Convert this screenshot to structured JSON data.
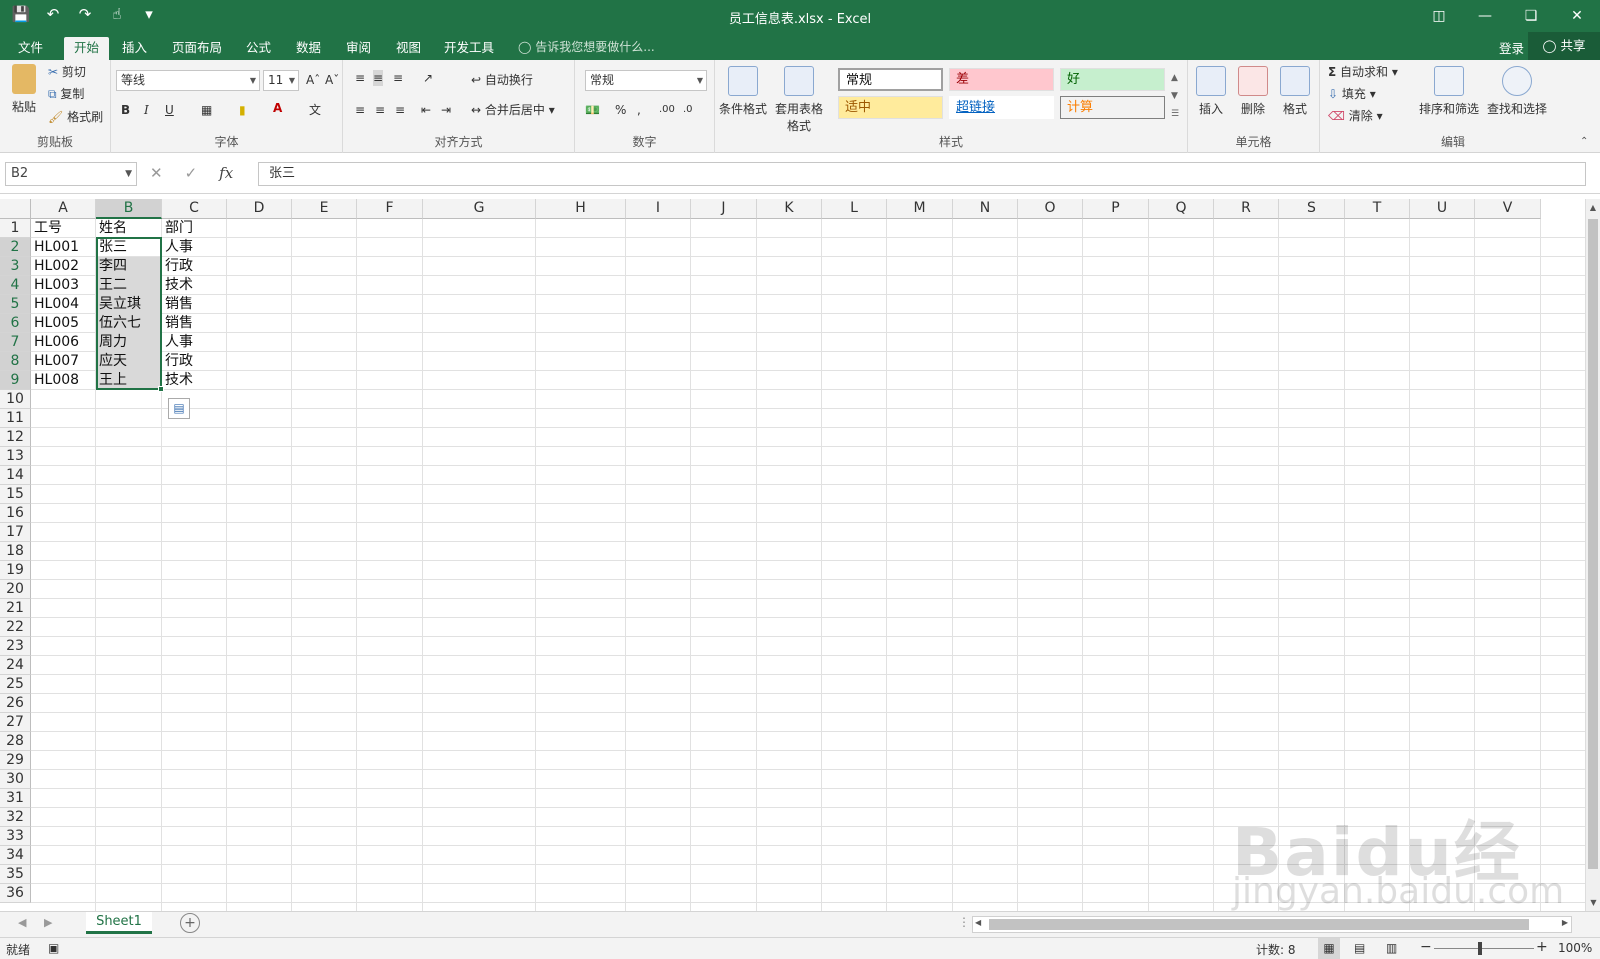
{
  "window": {
    "title": "员工信息表.xlsx - Excel"
  },
  "tabs": [
    "文件",
    "开始",
    "插入",
    "页面布局",
    "公式",
    "数据",
    "审阅",
    "视图",
    "开发工具"
  ],
  "tellme": "告诉我您想要做什么...",
  "account": {
    "login": "登录",
    "share": "共享"
  },
  "clipboard": {
    "paste": "粘贴",
    "cut": "剪切",
    "copy": "复制",
    "painter": "格式刷",
    "label": "剪贴板"
  },
  "font": {
    "name": "等线",
    "size": "11",
    "label": "字体"
  },
  "align": {
    "wrap": "自动换行",
    "merge": "合并后居中",
    "label": "对齐方式"
  },
  "number": {
    "format": "常规",
    "label": "数字"
  },
  "styles": {
    "cond": "条件格式",
    "table": "套用表格格式",
    "cells": [
      "常规",
      "差",
      "好",
      "适中",
      "超链接",
      "计算"
    ],
    "label": "样式"
  },
  "cells_group": {
    "insert": "插入",
    "delete": "删除",
    "format": "格式",
    "label": "单元格"
  },
  "editing": {
    "autosum": "自动求和",
    "fill": "填充",
    "clear": "清除",
    "sort": "排序和筛选",
    "find": "查找和选择",
    "label": "编辑"
  },
  "formula": {
    "namebox": "B2",
    "value": "张三"
  },
  "columns": [
    "A",
    "B",
    "C",
    "D",
    "E",
    "F",
    "G",
    "H",
    "I",
    "J",
    "K",
    "L",
    "M",
    "N",
    "O",
    "P",
    "Q",
    "R",
    "S",
    "T",
    "U",
    "V"
  ],
  "rows": [
    "1",
    "2",
    "3",
    "4",
    "5",
    "6",
    "7",
    "8",
    "9",
    "10",
    "11",
    "12",
    "13",
    "14",
    "15",
    "16",
    "17",
    "18",
    "19",
    "20",
    "21",
    "22",
    "23",
    "24",
    "25",
    "26",
    "27",
    "28",
    "29",
    "30",
    "31",
    "32",
    "33",
    "34",
    "35",
    "36"
  ],
  "table": [
    [
      "工号",
      "姓名",
      "部门"
    ],
    [
      "HL001",
      "张三",
      "人事"
    ],
    [
      "HL002",
      "李四",
      "行政"
    ],
    [
      "HL003",
      "王二",
      "技术"
    ],
    [
      "HL004",
      "吴立琪",
      "销售"
    ],
    [
      "HL005",
      "伍六七",
      "销售"
    ],
    [
      "HL006",
      "周力",
      "人事"
    ],
    [
      "HL007",
      "应天",
      "行政"
    ],
    [
      "HL008",
      "王上",
      "技术"
    ]
  ],
  "sheet": {
    "name": "Sheet1"
  },
  "status": {
    "ready": "就绪",
    "count": "计数: 8",
    "zoom": "100%"
  },
  "watermark": {
    "brand": "Baidu经验",
    "url": "jingyan.baidu.com"
  },
  "colors": {
    "accent": "#217346",
    "bad_bg": "#ffc7ce",
    "good_bg": "#c6efce",
    "neutral_bg": "#ffeb9c"
  }
}
